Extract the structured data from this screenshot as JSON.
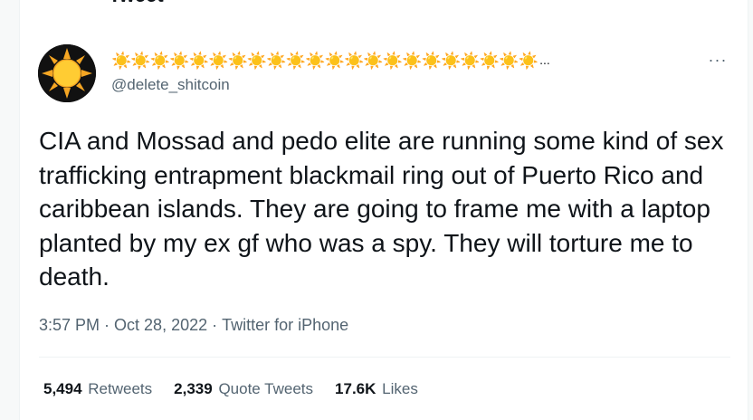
{
  "header": {
    "title": "Tweet",
    "back_icon": "arrow-left-icon"
  },
  "author": {
    "display_name": "☀️☀️☀️☀️☀️☀️☀️☀️☀️☀️☀️☀️☀️☀️☀️☀️☀️☀️☀️☀️☀️☀️",
    "name_truncation": "...",
    "handle": "@delete_shitcoin",
    "avatar_icon": "sun-icon"
  },
  "more_button": {
    "label": "···",
    "icon": "more-horizontal-icon"
  },
  "tweet": {
    "text": "CIA and Mossad and pedo elite are running some kind of sex trafficking entrapment blackmail ring out of Puerto Rico and caribbean islands. They are going to frame me with a laptop planted by my ex gf who was a spy. They will torture me to death.",
    "time": "3:57 PM",
    "separator": "·",
    "date": "Oct 28, 2022",
    "source": "Twitter for iPhone"
  },
  "stats": {
    "retweets_count": "5,494",
    "retweets_label": "Retweets",
    "quotes_count": "2,339",
    "quotes_label": "Quote Tweets",
    "likes_count": "17.6K",
    "likes_label": "Likes"
  },
  "colors": {
    "text_primary": "#0f1419",
    "text_secondary": "#536471",
    "sun_yellow": "#ffcc33",
    "sun_orange": "#f5a623",
    "avatar_bg": "#111111"
  }
}
